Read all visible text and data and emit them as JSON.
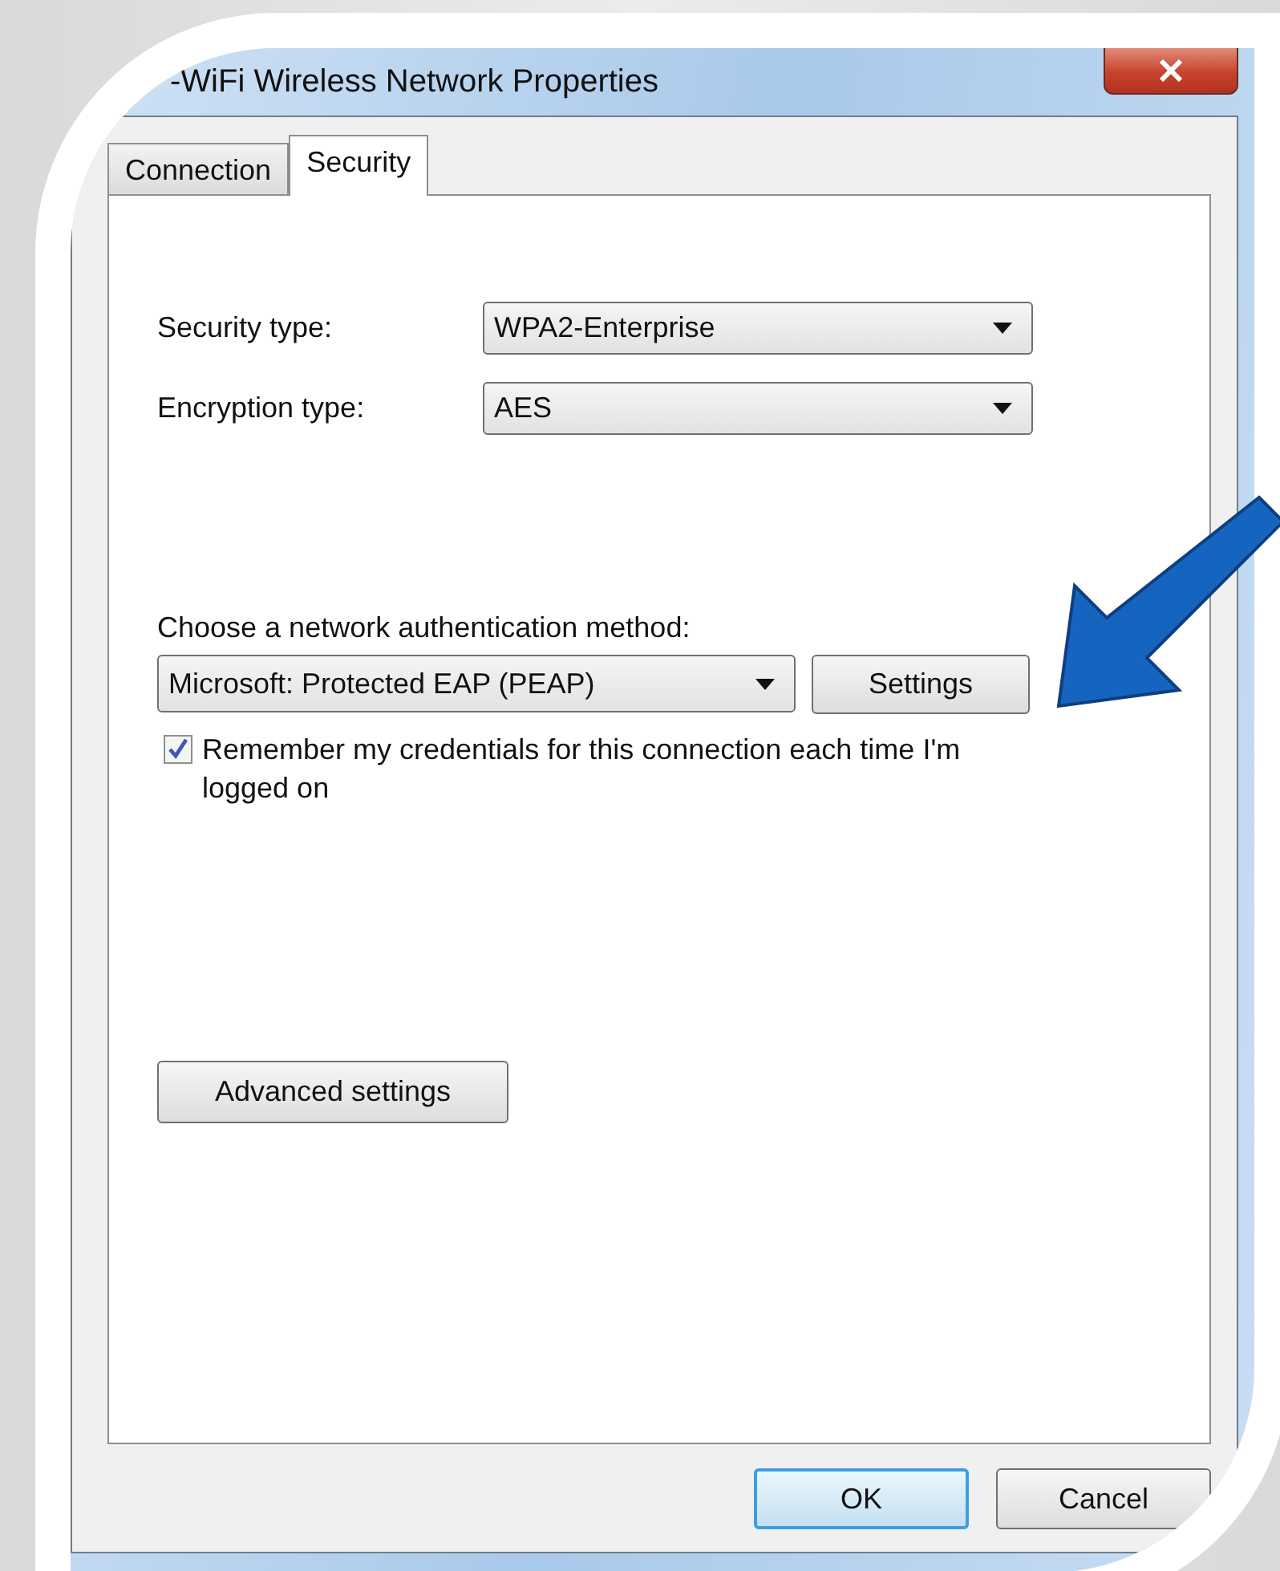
{
  "window": {
    "title": "-WiFi Wireless Network Properties"
  },
  "tabs": [
    {
      "label": "Connection",
      "selected": false
    },
    {
      "label": "Security",
      "selected": true
    }
  ],
  "fields": [
    {
      "label": "Security type:",
      "value": "WPA2-Enterprise"
    },
    {
      "label": "Encryption type:",
      "value": "AES"
    }
  ],
  "authentication": {
    "label": "Choose a network authentication method:",
    "method": "Microsoft: Protected EAP (PEAP)",
    "settings_button": "Settings"
  },
  "remember_credentials": {
    "label": "Remember my credentials for this connection each time I'm logged on",
    "checked": true
  },
  "advanced_button": "Advanced settings",
  "buttons": [
    {
      "label": "OK",
      "default": true
    },
    {
      "label": "Cancel",
      "default": false
    }
  ]
}
